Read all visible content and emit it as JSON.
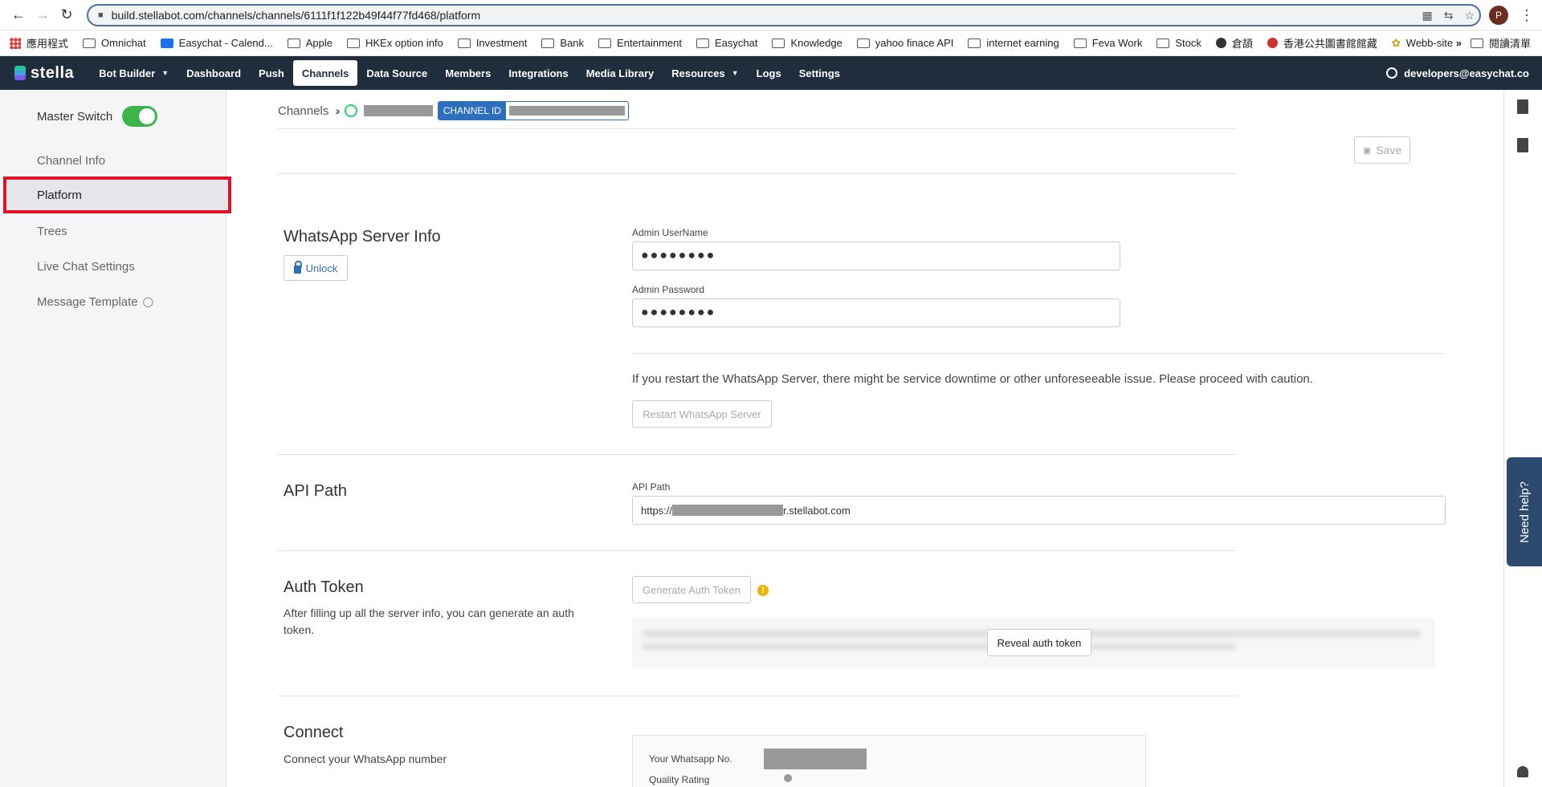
{
  "browser": {
    "url": "build.stellabot.com/channels/channels/6111f1f122b49f44f77fd468/platform",
    "avatar_letter": "P",
    "bookmarks": [
      "應用程式",
      "Omnichat",
      "Easychat - Calend...",
      "Apple",
      "HKEx option info",
      "Investment",
      "Bank",
      "Entertainment",
      "Easychat",
      "Knowledge",
      "yahoo finace API",
      "internet earning",
      "Feva Work",
      "Stock",
      "倉頡",
      "香港公共圖書館館藏",
      "Webb-site"
    ],
    "bookmark_more": "»",
    "reading_list": "閱讀清單"
  },
  "nav": {
    "logo": "stella",
    "items": [
      "Bot Builder",
      "Dashboard",
      "Push",
      "Channels",
      "Data Source",
      "Members",
      "Integrations",
      "Media Library",
      "Resources",
      "Logs",
      "Settings"
    ],
    "active": "Channels",
    "user": "developers@easychat.co"
  },
  "sidebar": {
    "master_switch": "Master Switch",
    "items": [
      "Channel Info",
      "Platform",
      "Trees",
      "Live Chat Settings",
      "Message Template"
    ],
    "active": "Platform"
  },
  "breadcrumb": {
    "root": "Channels",
    "channel_id_label": "CHANNEL ID"
  },
  "toolbar": {
    "save_label": "Save"
  },
  "server_info": {
    "title": "WhatsApp Server Info",
    "unlock_label": "Unlock",
    "admin_username_label": "Admin UserName",
    "admin_username_value": "●●●●●●●●",
    "admin_password_label": "Admin Password",
    "admin_password_value": "●●●●●●●●",
    "warning": "If you restart the WhatsApp Server, there might be service downtime or other unforeseeable issue. Please proceed with caution.",
    "restart_label": "Restart WhatsApp Server"
  },
  "api_path": {
    "title": "API Path",
    "label": "API Path",
    "prefix": "https://",
    "suffix": "r.stellabot.com"
  },
  "auth_token": {
    "title": "Auth Token",
    "description": "After filling up all the server info, you can generate an auth token.",
    "generate_label": "Generate Auth Token",
    "info_glyph": "!",
    "reveal_label": "Reveal auth token"
  },
  "connect": {
    "title": "Connect",
    "description": "Connect your WhatsApp number",
    "number_label": "Your Whatsapp No.",
    "quality_label": "Quality Rating"
  },
  "help": {
    "label": "Need help?"
  },
  "colors": {
    "nav_bg": "#1f2d3d",
    "accent": "#2d6fbd",
    "toggle_on": "#3bb54a",
    "highlight": "#e0122a"
  }
}
